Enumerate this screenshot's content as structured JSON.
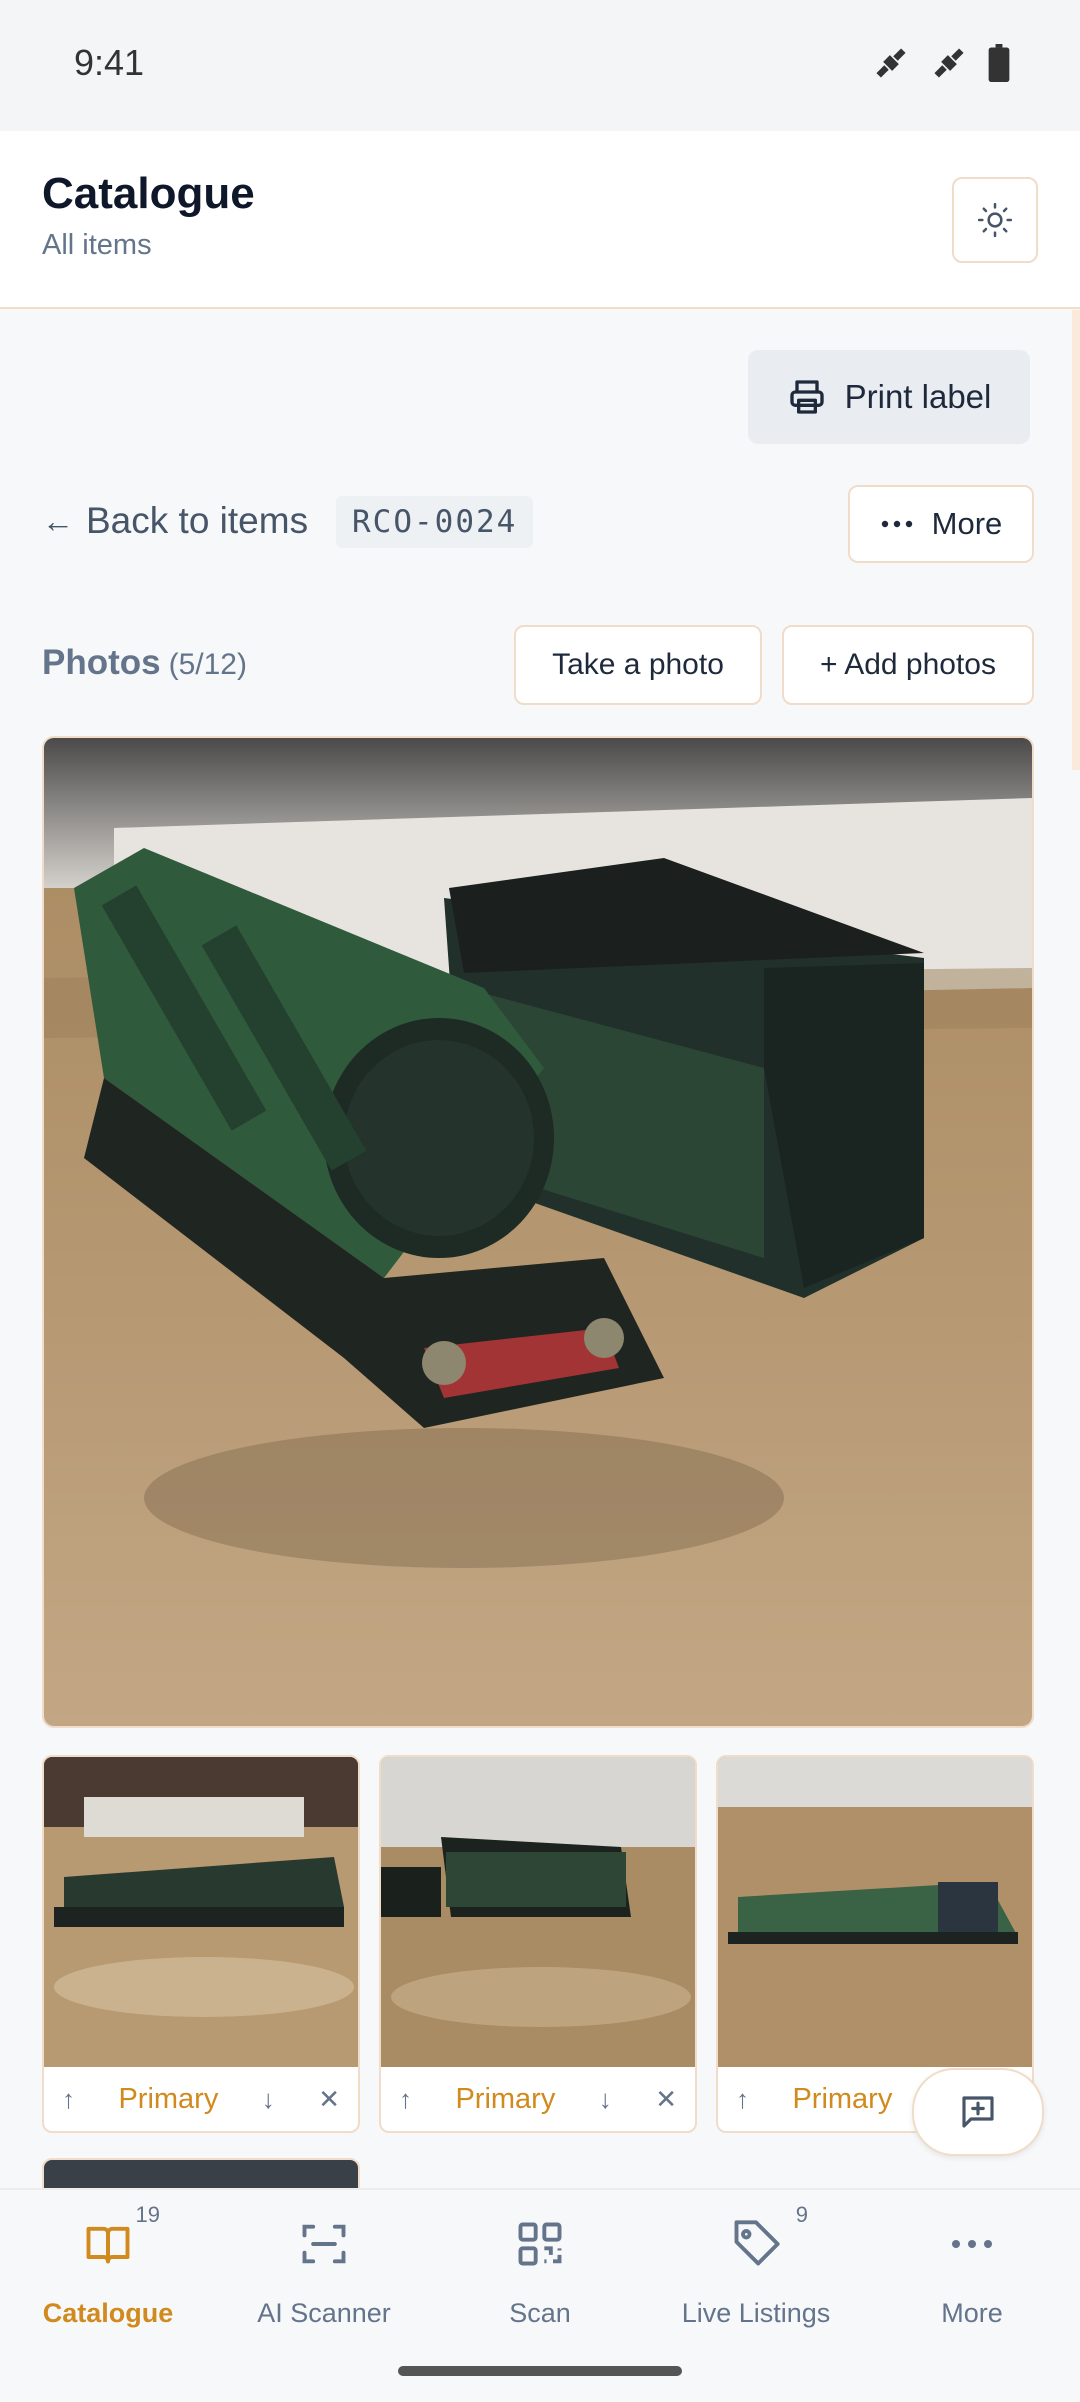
{
  "status_bar": {
    "time": "9:41"
  },
  "header": {
    "title": "Catalogue",
    "subtitle": "All items"
  },
  "toolbar": {
    "print_label": "Print label"
  },
  "item_nav": {
    "back_label": "Back to items",
    "sku": "RCO-0024",
    "more_label": "More"
  },
  "photos": {
    "label": "Photos",
    "count": "(5/12)",
    "take_photo_label": "Take a photo",
    "add_photos_label": "+ Add photos",
    "thumbnails": [
      {
        "primary_label": "Primary"
      },
      {
        "primary_label": "Primary"
      },
      {
        "primary_label": "Primary"
      }
    ]
  },
  "bottom_nav": {
    "items": [
      {
        "label": "Catalogue",
        "badge": "19",
        "icon": "book-icon"
      },
      {
        "label": "AI Scanner",
        "icon": "scan-frame-icon"
      },
      {
        "label": "Scan",
        "icon": "qr-code-icon"
      },
      {
        "label": "Live Listings",
        "badge": "9",
        "icon": "tag-icon"
      },
      {
        "label": "More",
        "icon": "more-horizontal-icon"
      }
    ]
  },
  "colors": {
    "accent": "#d08a1e",
    "border": "#f0dcc8",
    "muted": "#64748b"
  }
}
